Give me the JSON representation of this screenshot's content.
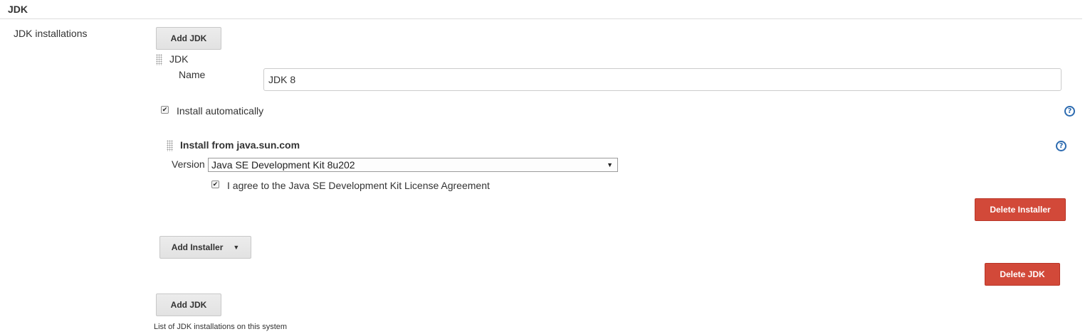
{
  "section": {
    "title": "JDK"
  },
  "jdk_installations": {
    "label": "JDK installations",
    "add_jdk_top": "Add JDK",
    "add_jdk_bottom": "Add JDK",
    "help_text": "List of JDK installations on this system"
  },
  "jdk_entry": {
    "header": "JDK",
    "name_label": "Name",
    "name_value": "JDK 8",
    "install_auto_label": "Install automatically",
    "install_auto_checked": true,
    "delete_jdk": "Delete JDK"
  },
  "installer": {
    "title": "Install from java.sun.com",
    "version_label": "Version",
    "version_selected": "Java SE Development Kit 8u202",
    "agree_label": "I agree to the Java SE Development Kit License Agreement",
    "agree_checked": true,
    "delete_installer": "Delete Installer",
    "add_installer": "Add Installer"
  },
  "icons": {
    "help": "help-icon",
    "drag": "drag-handle-icon",
    "check": "checkmark-icon",
    "dropdown": "chevron-down-icon"
  },
  "colors": {
    "delete_button": "#d24939",
    "help_icon": "#2d6bb0",
    "gray_button": "#e6e6e6"
  }
}
